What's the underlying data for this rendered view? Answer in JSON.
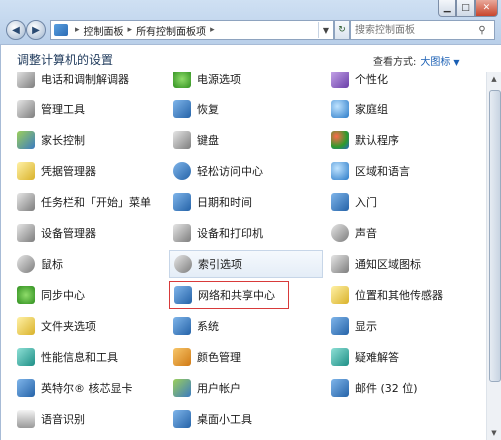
{
  "address": {
    "crumbs": [
      "控制面板",
      "所有控制面板项"
    ]
  },
  "search": {
    "placeholder": "搜索控制面板"
  },
  "header": {
    "title": "调整计算机的设置"
  },
  "view": {
    "label": "查看方式:",
    "value": "大图标"
  },
  "items": [
    {
      "label": "电话和调制解调器",
      "icon": "modem-icon"
    },
    {
      "label": "电源选项",
      "icon": "power-icon"
    },
    {
      "label": "个性化",
      "icon": "personalization-icon"
    },
    {
      "label": "管理工具",
      "icon": "admin-tools-icon"
    },
    {
      "label": "恢复",
      "icon": "recovery-icon"
    },
    {
      "label": "家庭组",
      "icon": "homegroup-icon"
    },
    {
      "label": "家长控制",
      "icon": "parental-controls-icon"
    },
    {
      "label": "键盘",
      "icon": "keyboard-icon"
    },
    {
      "label": "默认程序",
      "icon": "default-programs-icon"
    },
    {
      "label": "凭据管理器",
      "icon": "credential-manager-icon"
    },
    {
      "label": "轻松访问中心",
      "icon": "ease-of-access-icon"
    },
    {
      "label": "区域和语言",
      "icon": "region-language-icon"
    },
    {
      "label": "任务栏和「开始」菜单",
      "icon": "taskbar-icon"
    },
    {
      "label": "日期和时间",
      "icon": "date-time-icon"
    },
    {
      "label": "入门",
      "icon": "getting-started-icon"
    },
    {
      "label": "设备管理器",
      "icon": "device-manager-icon"
    },
    {
      "label": "设备和打印机",
      "icon": "devices-printers-icon"
    },
    {
      "label": "声音",
      "icon": "sound-icon"
    },
    {
      "label": "鼠标",
      "icon": "mouse-icon"
    },
    {
      "label": "索引选项",
      "icon": "indexing-icon"
    },
    {
      "label": "通知区域图标",
      "icon": "notification-area-icon"
    },
    {
      "label": "同步中心",
      "icon": "sync-center-icon"
    },
    {
      "label": "网络和共享中心",
      "icon": "network-sharing-icon"
    },
    {
      "label": "位置和其他传感器",
      "icon": "location-sensors-icon"
    },
    {
      "label": "文件夹选项",
      "icon": "folder-options-icon"
    },
    {
      "label": "系统",
      "icon": "system-icon"
    },
    {
      "label": "显示",
      "icon": "display-icon"
    },
    {
      "label": "性能信息和工具",
      "icon": "performance-icon"
    },
    {
      "label": "颜色管理",
      "icon": "color-management-icon"
    },
    {
      "label": "疑难解答",
      "icon": "troubleshooting-icon"
    },
    {
      "label": "英特尔® 核芯显卡",
      "icon": "intel-graphics-icon"
    },
    {
      "label": "用户帐户",
      "icon": "user-accounts-icon"
    },
    {
      "label": "邮件 (32 位)",
      "icon": "mail-icon"
    },
    {
      "label": "语音识别",
      "icon": "speech-recognition-icon"
    },
    {
      "label": "桌面小工具",
      "icon": "desktop-gadgets-icon"
    }
  ]
}
